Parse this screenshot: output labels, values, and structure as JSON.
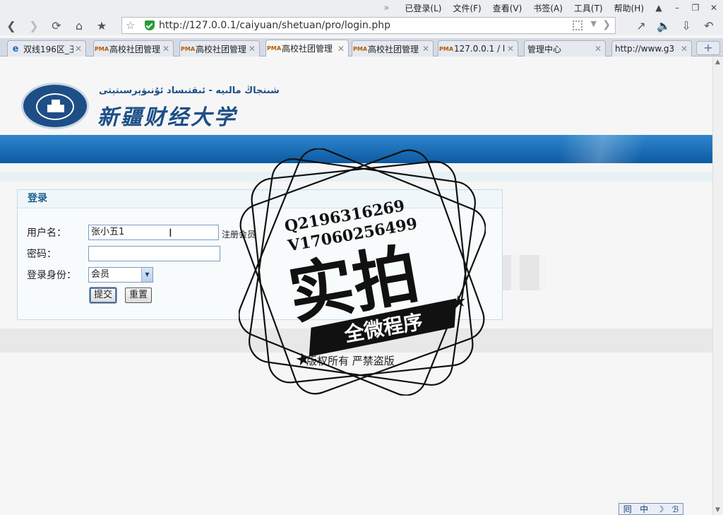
{
  "menubar": {
    "overflow": "»",
    "items": [
      "已登录(L)",
      "文件(F)",
      "查看(V)",
      "书签(A)",
      "工具(T)",
      "帮助(H)"
    ],
    "window_controls": [
      "skin",
      "minimize",
      "restore",
      "close"
    ]
  },
  "navbar": {
    "back": "back-icon",
    "forward": "forward-icon",
    "reload": "reload-icon",
    "home": "home-icon",
    "bookmark": "bookmark-icon",
    "url": "http://127.0.0.1/caiyuan/shetuan/pro/login.php"
  },
  "tabs": [
    {
      "label": "双线196区_王",
      "icon": "ie",
      "active": false
    },
    {
      "label": "高校社团管理",
      "icon": "pma",
      "active": false
    },
    {
      "label": "高校社团管理",
      "icon": "pma",
      "active": false
    },
    {
      "label": "高校社团管理",
      "icon": "pma",
      "active": true
    },
    {
      "label": "高校社团管理",
      "icon": "pma",
      "active": false
    },
    {
      "label": "127.0.0.1 / loca",
      "icon": "pma",
      "active": false
    },
    {
      "label": "管理中心",
      "icon": "page",
      "active": false
    },
    {
      "label": "http://www.g3",
      "icon": "page",
      "active": false
    }
  ],
  "newtab": "+",
  "header": {
    "logo_uyghur": "شىنجاڭ مالىيە - ئىقتىساد ئۇنىۋېرسىتېتى",
    "logo_chinese": "新疆财经大学"
  },
  "login": {
    "title": "登录",
    "username_label": "用户名：",
    "username_value": "张小五1",
    "register_link": "注册会员",
    "password_label": "密码：",
    "password_value": "",
    "role_label": "登录身份：",
    "role_selected": "会员",
    "submit": "提交",
    "reset": "重置"
  },
  "footer": {
    "copyright": "版权所有  严禁盗版"
  },
  "watermark": {
    "line1": "Q2196316269",
    "line2": "V17060256499",
    "big": "实拍",
    "ribbon": "全微程序"
  },
  "ime": {
    "items": [
      "囘",
      "中",
      "☽",
      "ℬ"
    ]
  }
}
